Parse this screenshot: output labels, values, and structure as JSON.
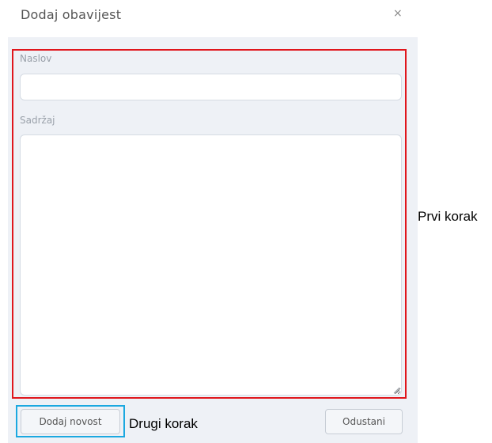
{
  "modal": {
    "title": "Dodaj obavijest",
    "close_icon": "close-icon",
    "close_glyph": "×"
  },
  "form": {
    "title_label": "Naslov",
    "title_value": "",
    "content_label": "Sadržaj",
    "content_value": ""
  },
  "buttons": {
    "submit_label": "Dodaj novost",
    "cancel_label": "Odustani"
  },
  "annotations": {
    "first_step": "Prvi korak",
    "second_step": "Drugi korak",
    "first_step_color": "#e0161c",
    "second_step_color": "#1ba8e0"
  }
}
